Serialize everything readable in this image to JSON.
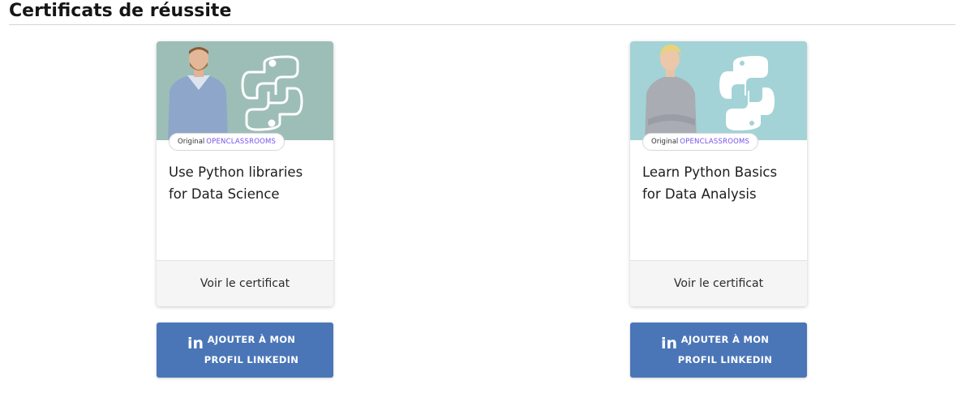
{
  "section": {
    "title": "Certificats de réussite"
  },
  "certificates": [
    {
      "badge_original": "Original",
      "badge_brand": "OPENCLASSROOMS",
      "title": "Use Python libraries for Data Science",
      "view_label": "Voir le certificat",
      "linkedin_label": "AJOUTER À MON PROFIL LINKEDIN",
      "linkedin_icon_text": "in",
      "image_bg": "#9dbeb6",
      "icon": "python-logo-icon"
    },
    {
      "badge_original": "Original",
      "badge_brand": "OPENCLASSROOMS",
      "title": "Learn Python Basics for Data Analysis",
      "view_label": "Voir le certificat",
      "linkedin_label": "AJOUTER À MON PROFIL LINKEDIN",
      "linkedin_icon_text": "in",
      "image_bg": "#a3d3d6",
      "icon": "python-logo-icon"
    }
  ],
  "colors": {
    "brand_purple": "#7451eb",
    "linkedin_blue": "#4a76b8",
    "footer_bg": "#f5f5f5"
  }
}
